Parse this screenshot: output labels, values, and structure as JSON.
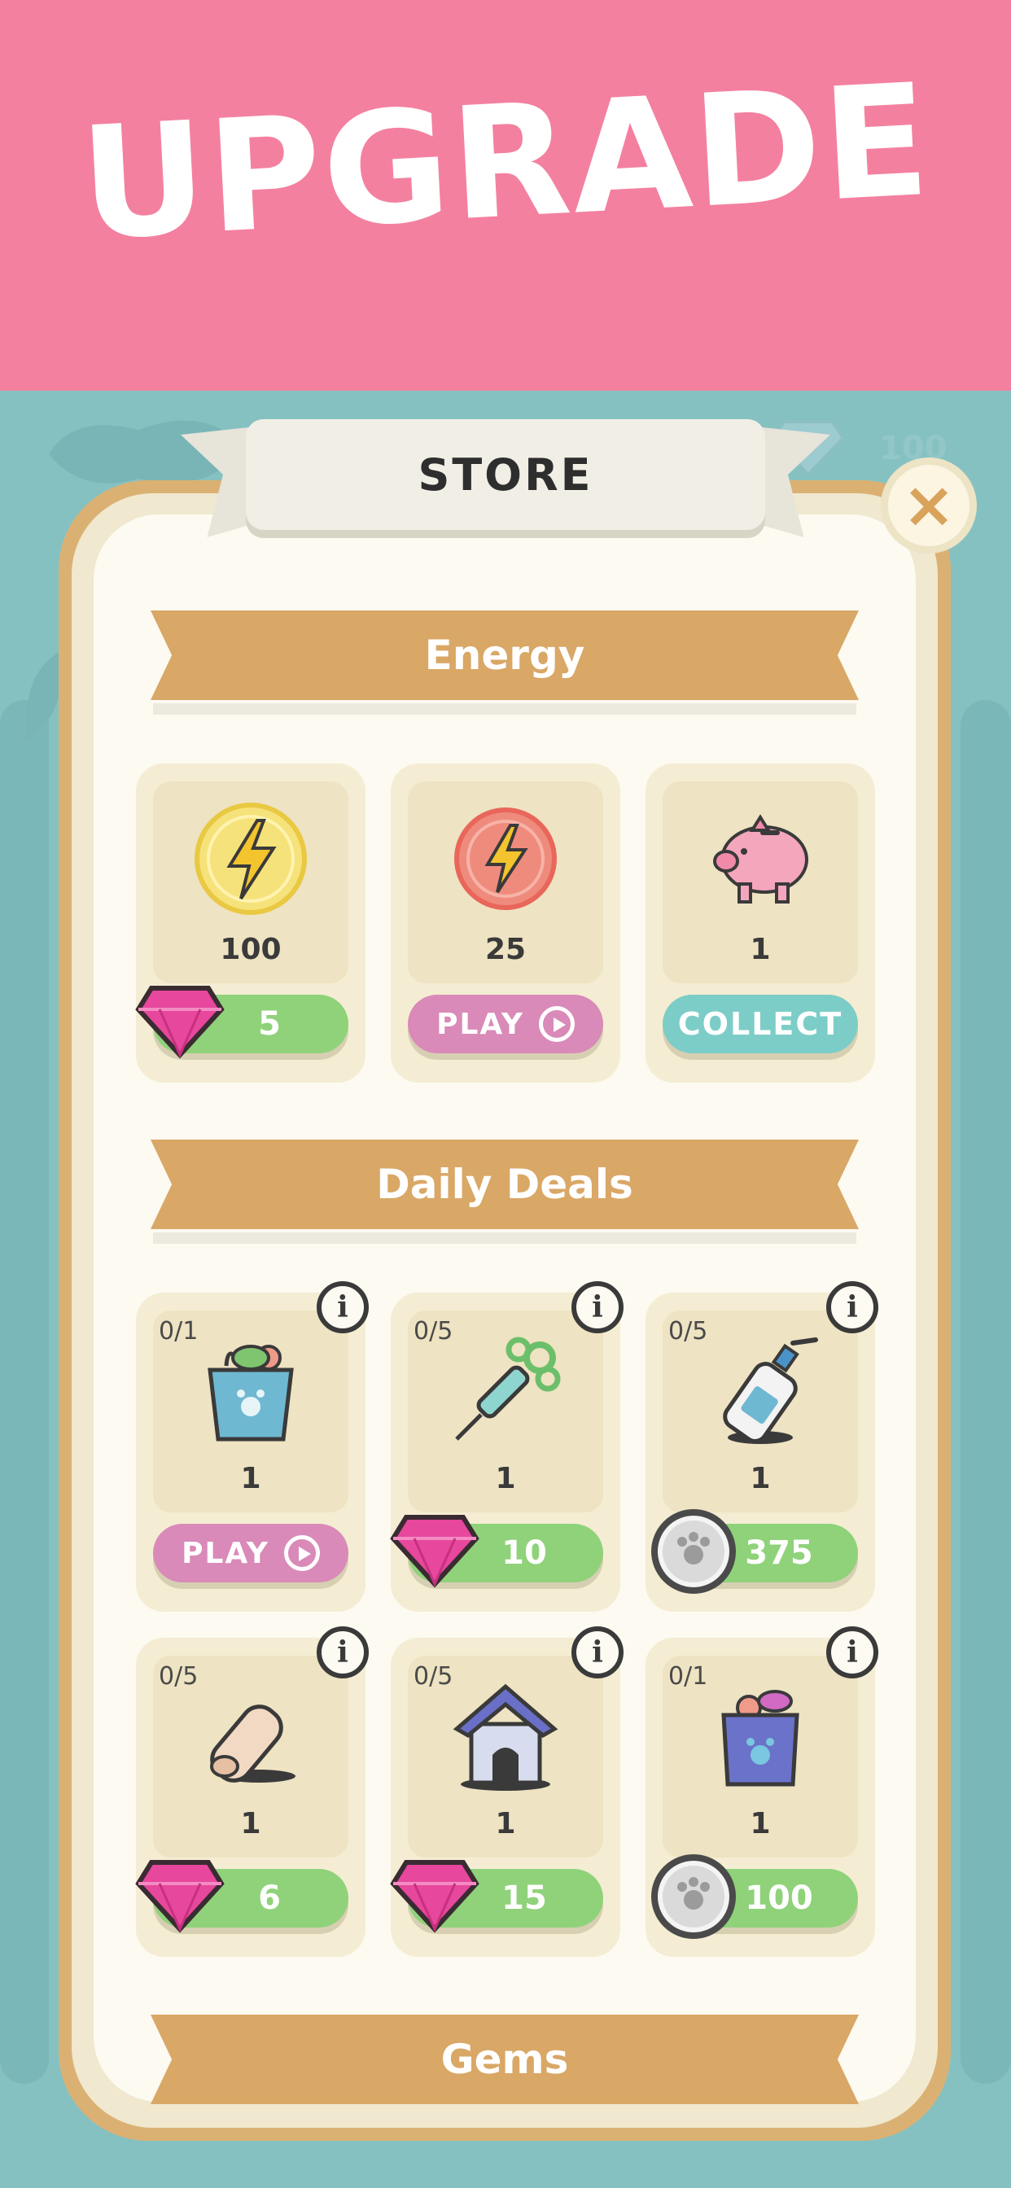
{
  "banner": {
    "title": "UPGRADE"
  },
  "header": {
    "title": "STORE",
    "close_label": "×",
    "top_gem_count": "100"
  },
  "energy": {
    "title": "Energy",
    "items": [
      {
        "count": "100",
        "button": "5"
      },
      {
        "count": "25",
        "button": "PLAY"
      },
      {
        "count": "1",
        "button": "COLLECT"
      }
    ]
  },
  "daily": {
    "title": "Daily Deals",
    "info": "i",
    "items": [
      {
        "progress": "0/1",
        "count": "1",
        "button": "PLAY"
      },
      {
        "progress": "0/5",
        "count": "1",
        "button": "10"
      },
      {
        "progress": "0/5",
        "count": "1",
        "button": "375"
      },
      {
        "progress": "0/5",
        "count": "1",
        "button": "6"
      },
      {
        "progress": "0/5",
        "count": "1",
        "button": "15"
      },
      {
        "progress": "0/1",
        "count": "1",
        "button": "100"
      }
    ]
  },
  "gems": {
    "title": "Gems"
  },
  "colors": {
    "banner": "#f4809f",
    "background": "#86c1c2",
    "panel_border": "#dbb173",
    "ribbon": "#d9a766",
    "green_button": "#8fd27a",
    "pink_button": "#d98ab8",
    "teal_button": "#7ccdc7"
  }
}
